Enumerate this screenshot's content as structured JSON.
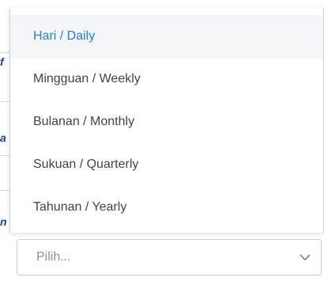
{
  "dropdown": {
    "options": [
      {
        "label": "Hari / Daily",
        "selected": true
      },
      {
        "label": "Mingguan / Weekly",
        "selected": false
      },
      {
        "label": "Bulanan / Monthly",
        "selected": false
      },
      {
        "label": "Sukuan / Quarterly",
        "selected": false
      },
      {
        "label": "Tahunan / Yearly",
        "selected": false
      }
    ]
  },
  "select": {
    "placeholder": "Pilih...",
    "icon": "chevron-down-icon"
  },
  "colors": {
    "selected_text": "#2f7ccc",
    "selected_bg": "#f3f5f8",
    "text": "#3d4451",
    "placeholder": "#8a9099",
    "border": "#c9cdd3"
  }
}
